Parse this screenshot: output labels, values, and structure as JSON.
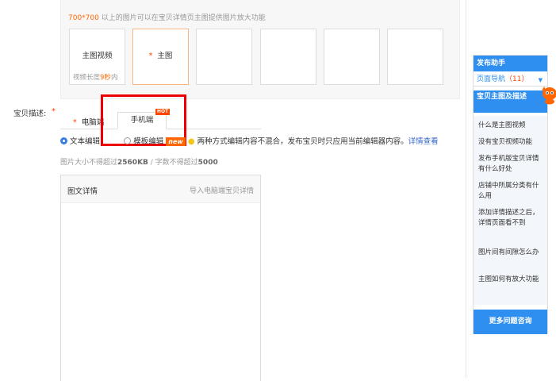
{
  "main_image": {
    "hint_size": "700*700",
    "hint_text": " 以上的图片可以在宝贝详情页主图提供图片放大功能",
    "video_slot_label": "主图视频",
    "video_length_prefix": "视频长度",
    "video_length_num": "9秒",
    "video_length_suffix": "内",
    "main_slot_star": "*",
    "main_slot_label": "主图"
  },
  "description": {
    "label": "宝贝描述:",
    "required_star": "*",
    "tab_pc_star": "*",
    "tab_pc": "电脑端",
    "tab_mobile": "手机端",
    "hot_badge": "HOT",
    "radio_text_label": "文本编辑",
    "radio_template_label": "模板编辑",
    "new_badge": "new",
    "notice": "两种方式编辑内容不混合，发布宝贝时只应用当前编辑器内容。",
    "notice_link": "详情查看",
    "limit_prefix": "图片大小不得超过",
    "limit_size": "2560KB",
    "limit_middle": " / 字数不得超过",
    "limit_words": "5000",
    "editor_title": "图文详情",
    "editor_import": "导入电脑端宝贝详情"
  },
  "helper": {
    "title": "发布助手",
    "nav_label": "页面导航",
    "nav_count": "（11）",
    "section_title": "宝贝主图及描述",
    "questions": [
      "什么是主图视频",
      "没有宝贝视频功能",
      "发布手机版宝贝详情有什么好处",
      "店铺中所属分类有什么用",
      "添加详情描述之后，详情页面看不到",
      "图片间有间隙怎么办",
      "主图如何有放大功能"
    ],
    "more_button": "更多问题咨询"
  },
  "colors": {
    "accent": "#2f8ff0",
    "warning": "#ff6600",
    "highlight_box": "#ee0000"
  }
}
